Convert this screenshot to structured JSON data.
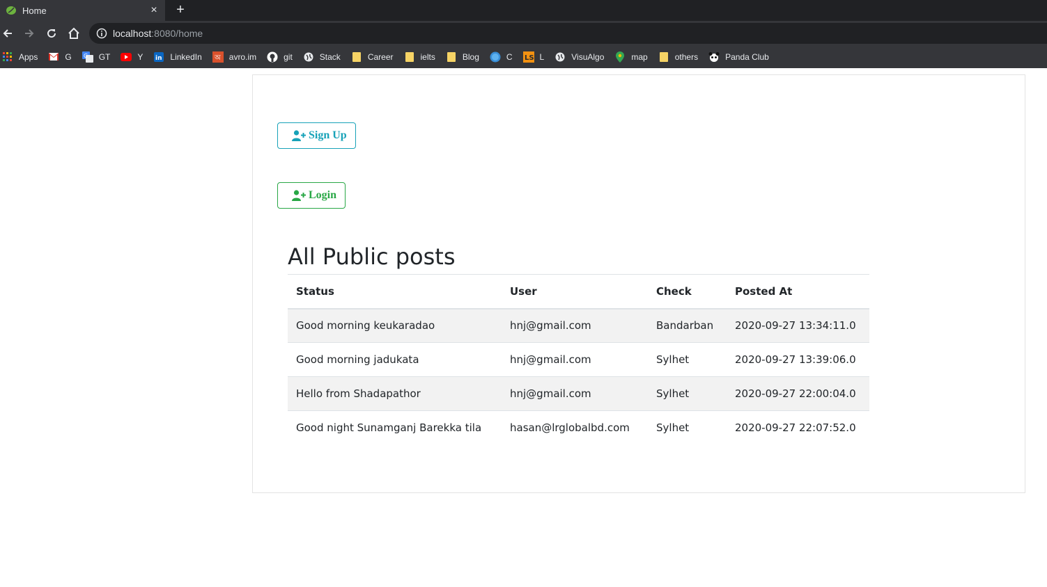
{
  "browser": {
    "tab_title": "Home",
    "close_glyph": "×",
    "newtab_glyph": "+",
    "url_host": "localhost",
    "url_rest": ":8080/home"
  },
  "bookmarks": [
    {
      "label": "Apps",
      "icon": "apps-grid-icon",
      "color": "#ea4335"
    },
    {
      "label": "G",
      "icon": "gmail-icon",
      "color": "#d93025"
    },
    {
      "label": "GT",
      "icon": "google-translate-icon",
      "color": "#4285f4"
    },
    {
      "label": "Y",
      "icon": "youtube-icon",
      "color": "#ff0000"
    },
    {
      "label": "LinkedIn",
      "icon": "linkedin-icon",
      "color": "#0a66c2"
    },
    {
      "label": "avro.im",
      "icon": "avro-icon",
      "color": "#d9512c"
    },
    {
      "label": "git",
      "icon": "github-icon",
      "color": "#ffffff"
    },
    {
      "label": "Stack",
      "icon": "globe-icon",
      "color": "#e8eaed"
    },
    {
      "label": "Career",
      "icon": "folder-icon",
      "color": "#f6d365"
    },
    {
      "label": "ielts",
      "icon": "folder-icon",
      "color": "#f6d365"
    },
    {
      "label": "Blog",
      "icon": "folder-icon",
      "color": "#f6d365"
    },
    {
      "label": "C",
      "icon": "circle-icon",
      "color": "#3a8fd8"
    },
    {
      "label": "L",
      "icon": "letter-l-icon",
      "color": "#f29111"
    },
    {
      "label": "VisuAlgo",
      "icon": "globe-icon",
      "color": "#e8eaed"
    },
    {
      "label": "map",
      "icon": "maps-pin-icon",
      "color": "#34a853"
    },
    {
      "label": "others",
      "icon": "folder-icon",
      "color": "#f6d365"
    },
    {
      "label": "Panda Club",
      "icon": "panda-icon",
      "color": "#ffffff"
    }
  ],
  "page": {
    "signup_label": "Sign Up",
    "login_label": "Login",
    "heading": "All Public posts",
    "colors": {
      "signup": "#17a2b8",
      "login": "#28a745"
    }
  },
  "table": {
    "headers": [
      "Status",
      "User",
      "Check",
      "Posted At"
    ],
    "rows": [
      [
        "Good morning keukaradao",
        "hnj@gmail.com",
        "Bandarban",
        "2020-09-27 13:34:11.0"
      ],
      [
        "Good morning jadukata",
        "hnj@gmail.com",
        "Sylhet",
        "2020-09-27 13:39:06.0"
      ],
      [
        "Hello from Shadapathor",
        "hnj@gmail.com",
        "Sylhet",
        "2020-09-27 22:00:04.0"
      ],
      [
        "Good night Sunamganj Barekka tila",
        "hasan@lrglobalbd.com",
        "Sylhet",
        "2020-09-27 22:07:52.0"
      ]
    ]
  }
}
